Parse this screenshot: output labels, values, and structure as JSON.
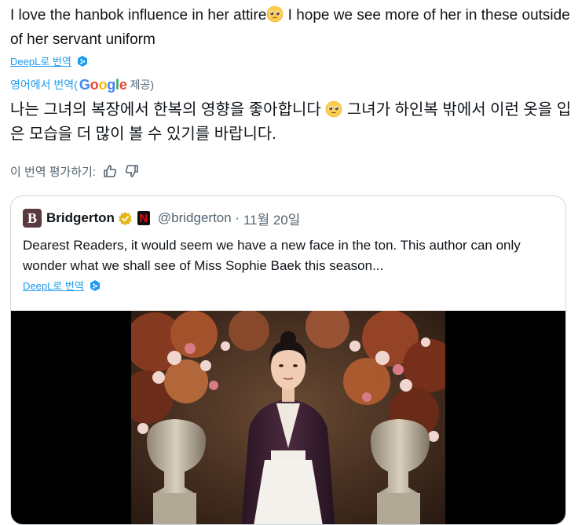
{
  "reply": {
    "text_part1": "I love the hanbok influence in her attire",
    "text_part2": " I hope we see more of her in these outside of her servant uniform",
    "deepl_label": "DeepL로 번역",
    "google_prefix": "영어에서 번역(",
    "google_brand": "Google",
    "google_suffix": " 제공)",
    "translated_part1": "나는 그녀의 복장에서 한복의 영향을 좋아합니다 ",
    "translated_part2": " 그녀가 하인복 밖에서 이런 옷을 입은 모습을 더 많이 볼 수 있기를 바랍니다.",
    "rate_label": "이 번역 평가하기:"
  },
  "quoted": {
    "avatar_letter": "B",
    "name": "Bridgerton",
    "netflix_letter": "N",
    "handle": "@bridgerton",
    "separator": " · ",
    "date": "11월 20일",
    "text": "Dearest Readers, it would seem we have a new face in the ton. This author can only wonder what we shall see of Miss Sophie Baek this season...",
    "deepl_label": "DeepL로 번역"
  },
  "colors": {
    "link": "#1d9bf0",
    "secondary": "#536471",
    "verified_gold": "#e2b719",
    "netflix_red": "#e50914"
  },
  "icons": [
    "pleading-face-emoji",
    "deepl-icon",
    "thumbs-up-icon",
    "thumbs-down-icon",
    "verified-badge-icon",
    "netflix-icon"
  ]
}
